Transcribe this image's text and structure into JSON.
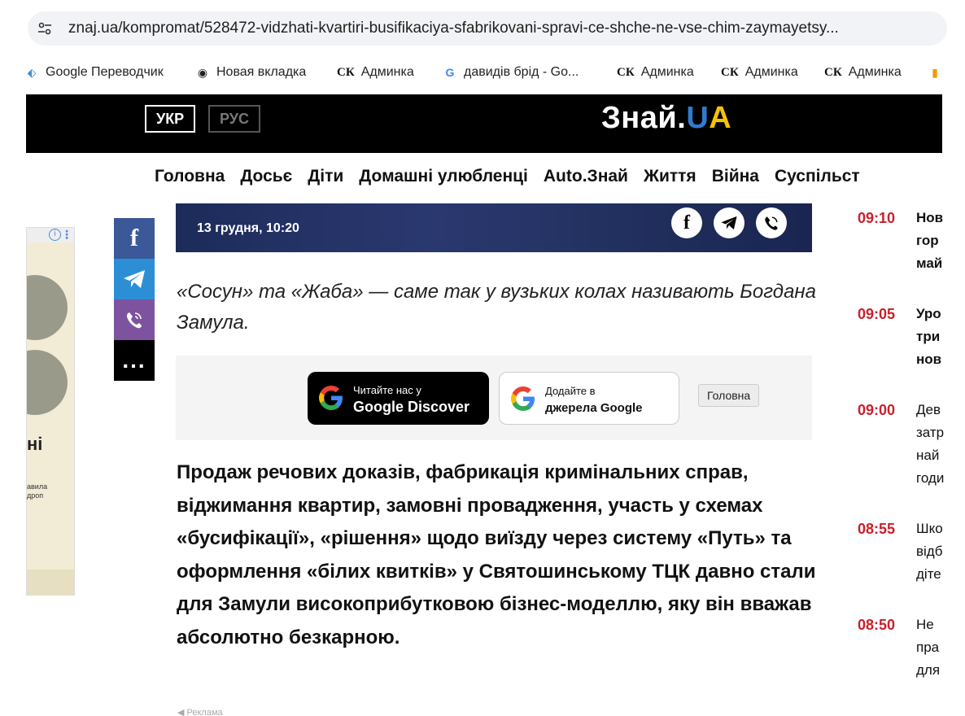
{
  "browser": {
    "url": "znaj.ua/kompromat/528472-vidzhati-kvartiri-busifikaciya-sfabrikovani-spravi-ce-shche-ne-vse-chim-zaymayetsy..."
  },
  "bookmarks": [
    {
      "label": "Google Переводчик",
      "icon": "google-translate-icon"
    },
    {
      "label": "Новая вкладка",
      "icon": "chrome-icon"
    },
    {
      "prefix": "СК",
      "label": "Админка",
      "icon": "sk-icon"
    },
    {
      "label": "давидів брід - Go...",
      "icon": "google-icon"
    },
    {
      "prefix": "СК",
      "label": "Админка",
      "icon": "sk-icon"
    },
    {
      "prefix": "СК",
      "label": "Админка",
      "icon": "sk-icon"
    },
    {
      "prefix": "СК",
      "label": "Админка",
      "icon": "sk-icon"
    }
  ],
  "header": {
    "lang_ukr": "УКР",
    "lang_rus": "РУС",
    "logo_main": "Знай.",
    "logo_u": "U",
    "logo_a": "A"
  },
  "nav": [
    "Головна",
    "Досьє",
    "Діти",
    "Домашні улюбленці",
    "Auto.Знай",
    "Життя",
    "Війна",
    "Суспільст"
  ],
  "left_ad": {
    "title": "ні",
    "small": "авила\nдроп"
  },
  "share": {
    "facebook": "f",
    "more": "..."
  },
  "article": {
    "date": "13 грудня, 10:20",
    "lead": "«Сосун» та «Жаба» — саме так у вузьких колах називають Богдана Замула.",
    "body": "Продаж речових доказів, фабрикація кримінальних справ, віджимання квартир, замовні провадження, участь у схемах «бусифікації», «рішення» щодо виїзду через систему «Путь» та оформлення «білих квитків» у Святошинському ТЦК давно стали для Замули високоприбутковою бізнес-моделлю, яку він вважав абсолютно безкарною.",
    "ad_label": "Реклама"
  },
  "discover": {
    "gd_small": "Читайте нас у",
    "gd_big": "Google Discover",
    "gs_small": "Додайте в",
    "gs_big": "джерела Google",
    "home": "Головна"
  },
  "news": [
    {
      "time": "09:10",
      "title": "Нов\nгор\nмай",
      "bold": true
    },
    {
      "time": "09:05",
      "title": "Уро\nтри\nнов",
      "bold": true
    },
    {
      "time": "09:00",
      "title": "Дев\nзатр\nнай\nгоди",
      "bold": false
    },
    {
      "time": "08:55",
      "title": "Шко\nвідб\nдіте",
      "bold": false
    },
    {
      "time": "08:50",
      "title": "Не\nпра\nдля",
      "bold": false
    }
  ],
  "colors": {
    "news_time": "#c8202b",
    "facebook": "#3b5998",
    "telegram": "#2c8fd6",
    "viber": "#7d529e"
  }
}
